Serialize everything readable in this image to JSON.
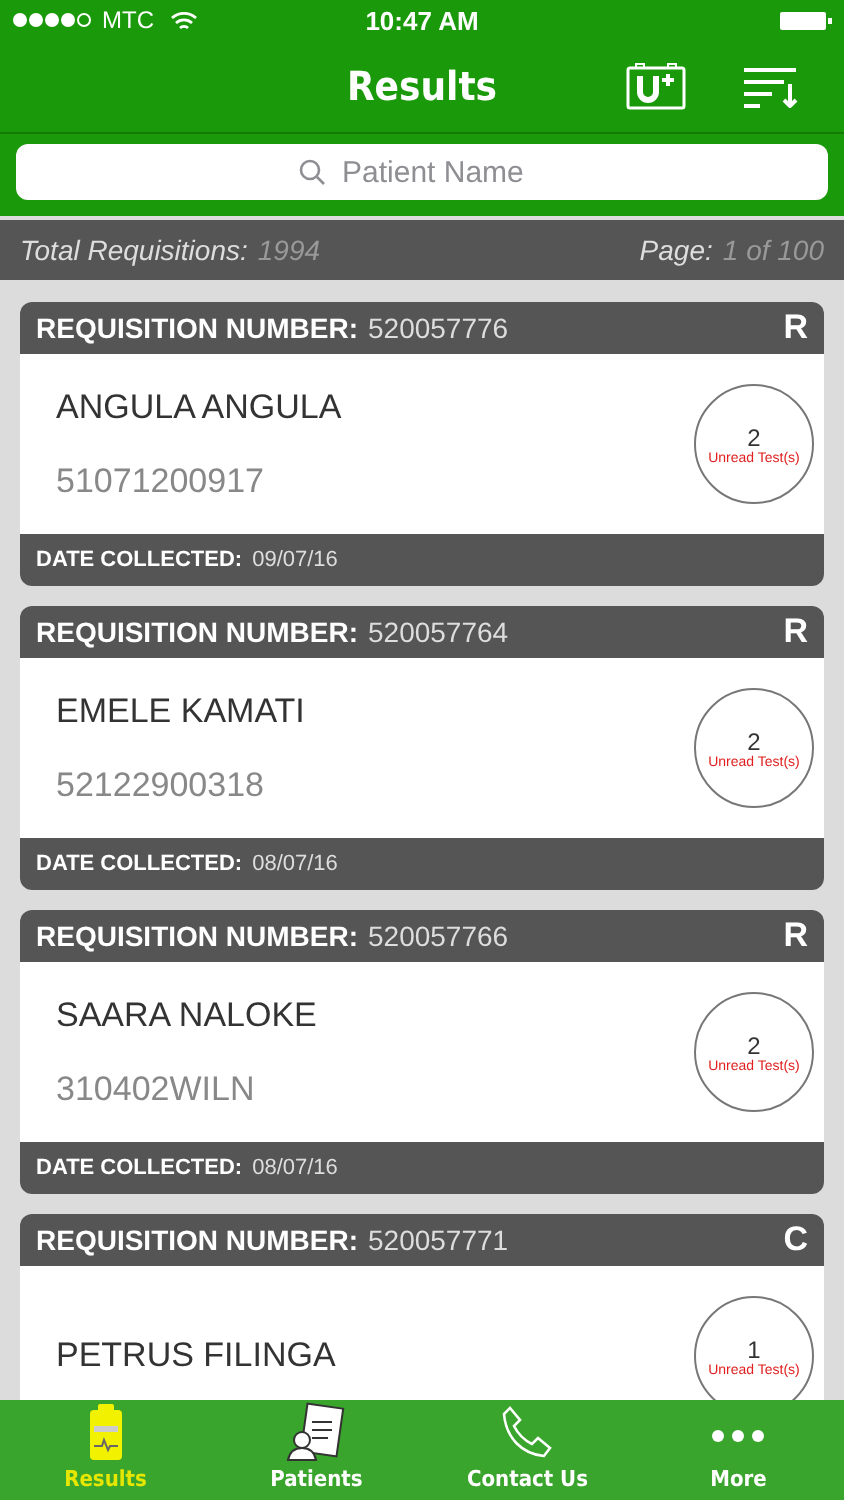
{
  "status_bar": {
    "carrier": "MTC",
    "time": "10:47 AM"
  },
  "nav": {
    "title": "Results"
  },
  "search": {
    "placeholder": "Patient Name"
  },
  "summary": {
    "total_label": "Total Requisitions:",
    "total_value": "1994",
    "page_label": "Page:",
    "page_value": "1 of 100"
  },
  "requisitions": [
    {
      "label": "REQUISITION NUMBER:",
      "number": "520057776",
      "code": "R",
      "patient": "ANGULA ANGULA",
      "patient_id": "51071200917",
      "unread_count": "2",
      "unread_label": "Unread Test(s)",
      "date_label": "DATE COLLECTED:",
      "date": "09/07/16"
    },
    {
      "label": "REQUISITION NUMBER:",
      "number": "520057764",
      "code": "R",
      "patient": "EMELE KAMATI",
      "patient_id": "52122900318",
      "unread_count": "2",
      "unread_label": "Unread Test(s)",
      "date_label": "DATE COLLECTED:",
      "date": "08/07/16"
    },
    {
      "label": "REQUISITION NUMBER:",
      "number": "520057766",
      "code": "R",
      "patient": "SAARA NALOKE",
      "patient_id": "310402WILN",
      "unread_count": "2",
      "unread_label": "Unread Test(s)",
      "date_label": "DATE COLLECTED:",
      "date": "08/07/16"
    },
    {
      "label": "REQUISITION NUMBER:",
      "number": "520057771",
      "code": "C",
      "patient": "PETRUS FILINGA",
      "unread_count": "1",
      "unread_label": "Unread Test(s)"
    }
  ],
  "tabs": [
    {
      "label": "Results",
      "kind": "clipboard",
      "selected": true
    },
    {
      "label": "Patients",
      "kind": "patient",
      "selected": false
    },
    {
      "label": "Contact Us",
      "kind": "phone",
      "selected": false
    },
    {
      "label": "More",
      "kind": "dots",
      "selected": false
    }
  ]
}
